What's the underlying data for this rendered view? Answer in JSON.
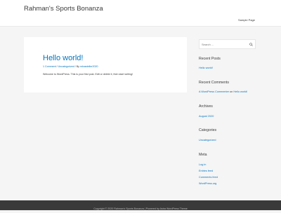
{
  "header": {
    "site_title": "Rahman's Sports Bonanza",
    "nav": [
      "Sample Page"
    ]
  },
  "post": {
    "title": "Hello world!",
    "comments_link": "1 Comment",
    "category_link": "Uncategorized",
    "by_label": "By",
    "author_link": "mkrasteller2020",
    "excerpt": "Welcome to WordPress. This is your first post. Edit or delete it, then start writing!"
  },
  "sidebar": {
    "search_placeholder": "Search ...",
    "recent_posts": {
      "title": "Recent Posts",
      "items": [
        "Hello world!"
      ]
    },
    "recent_comments": {
      "title": "Recent Comments",
      "commenter": "A WordPress Commenter",
      "on_label": "on",
      "post": "Hello world!"
    },
    "archives": {
      "title": "Archives",
      "items": [
        "August 2020"
      ]
    },
    "categories": {
      "title": "Categories",
      "items": [
        "Uncategorized"
      ]
    },
    "meta": {
      "title": "Meta",
      "items": [
        "Log in",
        "Entries feed",
        "Comments feed",
        "WordPress.org"
      ]
    }
  },
  "footer": {
    "text": "Copyright © 2020 Rahman's Sports Bonanza | Powered by Astra WordPress Theme"
  },
  "colors": {
    "link": "#0274be",
    "text": "#3a3a3a",
    "footer_bg": "#3a3a3a",
    "page_bg": "#f5f5f5"
  }
}
